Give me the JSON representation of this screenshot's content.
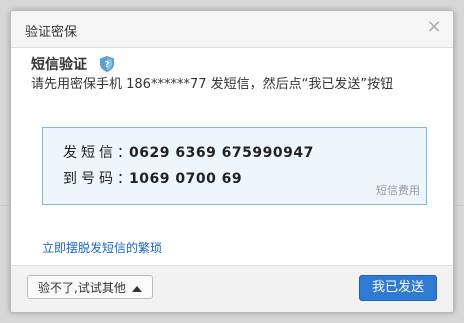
{
  "dialog": {
    "title": "验证密保",
    "close_symbol": "×"
  },
  "content": {
    "heading": "短信验证",
    "shield_icon": "shield-icon",
    "instruction": "请先用密保手机 186******77 发短信，然后点“我已发送”按钮",
    "sms": {
      "send_label": "发短信：",
      "send_value": "0629 6369 675990947",
      "to_label": "到号码：",
      "to_value": "1069 0700 69",
      "fee_note": "短信费用"
    },
    "link": "立即摆脱发短信的繁琐"
  },
  "footer": {
    "other_button": "验不了,试试其他",
    "sent_button": "我已发送"
  },
  "colors": {
    "primary": "#2f7bd4",
    "link": "#1b66c9",
    "sms_box_bg": "#edf6fc",
    "sms_box_border": "#7fb9e1"
  }
}
